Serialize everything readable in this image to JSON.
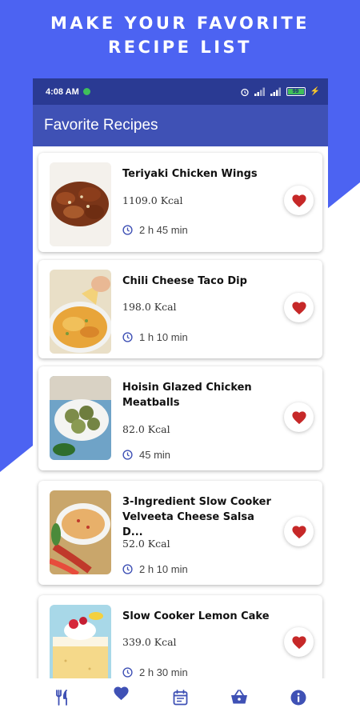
{
  "promo": {
    "title_line1": "MAKE YOUR FAVORITE",
    "title_line2": "RECIPE LIST",
    "background_color": "#4c63f2"
  },
  "status_bar": {
    "time": "4:08 AM",
    "battery": "99"
  },
  "app_bar": {
    "title": "Favorite Recipes",
    "color": "#3f51b5"
  },
  "recipes": [
    {
      "title": "Teriyaki Chicken Wings",
      "kcal": "1109.0 Kcal",
      "time": "2 h 45 min",
      "favorite": true
    },
    {
      "title": "Chili Cheese Taco Dip",
      "kcal": "198.0 Kcal",
      "time": "1 h 10 min",
      "favorite": true
    },
    {
      "title": "Hoisin Glazed Chicken Meatballs",
      "kcal": "82.0 Kcal",
      "time": "45 min",
      "favorite": true
    },
    {
      "title": "3-Ingredient Slow Cooker Velveeta Cheese Salsa D...",
      "kcal": "52.0 Kcal",
      "time": "2 h 10 min",
      "favorite": true
    },
    {
      "title": "Slow Cooker Lemon Cake",
      "kcal": "339.0 Kcal",
      "time": "2 h 30 min",
      "favorite": true
    }
  ],
  "bottom_nav": {
    "items": [
      {
        "icon": "fork-knife-icon",
        "active": false
      },
      {
        "icon": "heart-icon",
        "active": true
      },
      {
        "icon": "calendar-icon",
        "active": false
      },
      {
        "icon": "basket-icon",
        "active": false
      },
      {
        "icon": "info-icon",
        "active": false
      }
    ],
    "active_color": "#3f51b5",
    "heart_color": "#c62828"
  }
}
